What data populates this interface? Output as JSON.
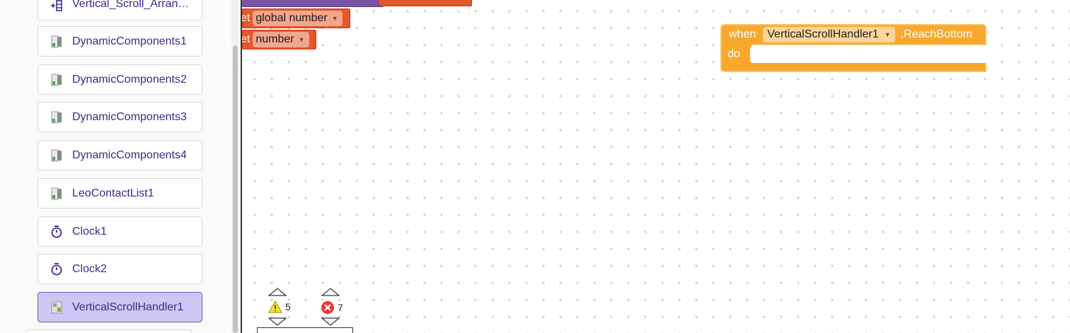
{
  "components": [
    {
      "label": "Vertical_Scroll_Arran…",
      "icon": "vertical-arrangement-icon",
      "selected": false
    },
    {
      "label": "DynamicComponents1",
      "icon": "extension-icon",
      "selected": false
    },
    {
      "label": "DynamicComponents2",
      "icon": "extension-icon",
      "selected": false
    },
    {
      "label": "DynamicComponents3",
      "icon": "extension-icon",
      "selected": false
    },
    {
      "label": "DynamicComponents4",
      "icon": "extension-icon",
      "selected": false
    },
    {
      "label": "LeoContactList1",
      "icon": "extension-icon",
      "selected": false
    },
    {
      "label": "Clock1",
      "icon": "stopwatch-icon",
      "selected": false
    },
    {
      "label": "Clock2",
      "icon": "stopwatch-icon",
      "selected": false
    },
    {
      "label": "VerticalScrollHandler1",
      "icon": "extension-icon",
      "selected": true
    }
  ],
  "blocks": {
    "set_prefix": "et",
    "set_global_var": "global number",
    "set_local_var": "number",
    "event": {
      "when_label": "when",
      "component": "VerticalScrollHandler1",
      "event_name": ".ReachBottom",
      "do_label": "do"
    }
  },
  "indicators": {
    "warnings_count": "5",
    "errors_count": "7"
  },
  "colors": {
    "accent_text": "#3a2a8c",
    "selected_bg": "#d0c6f3",
    "event_block": "#f8a92d",
    "variable_block": "#e8562a",
    "procedure_block": "#7a53a4"
  }
}
